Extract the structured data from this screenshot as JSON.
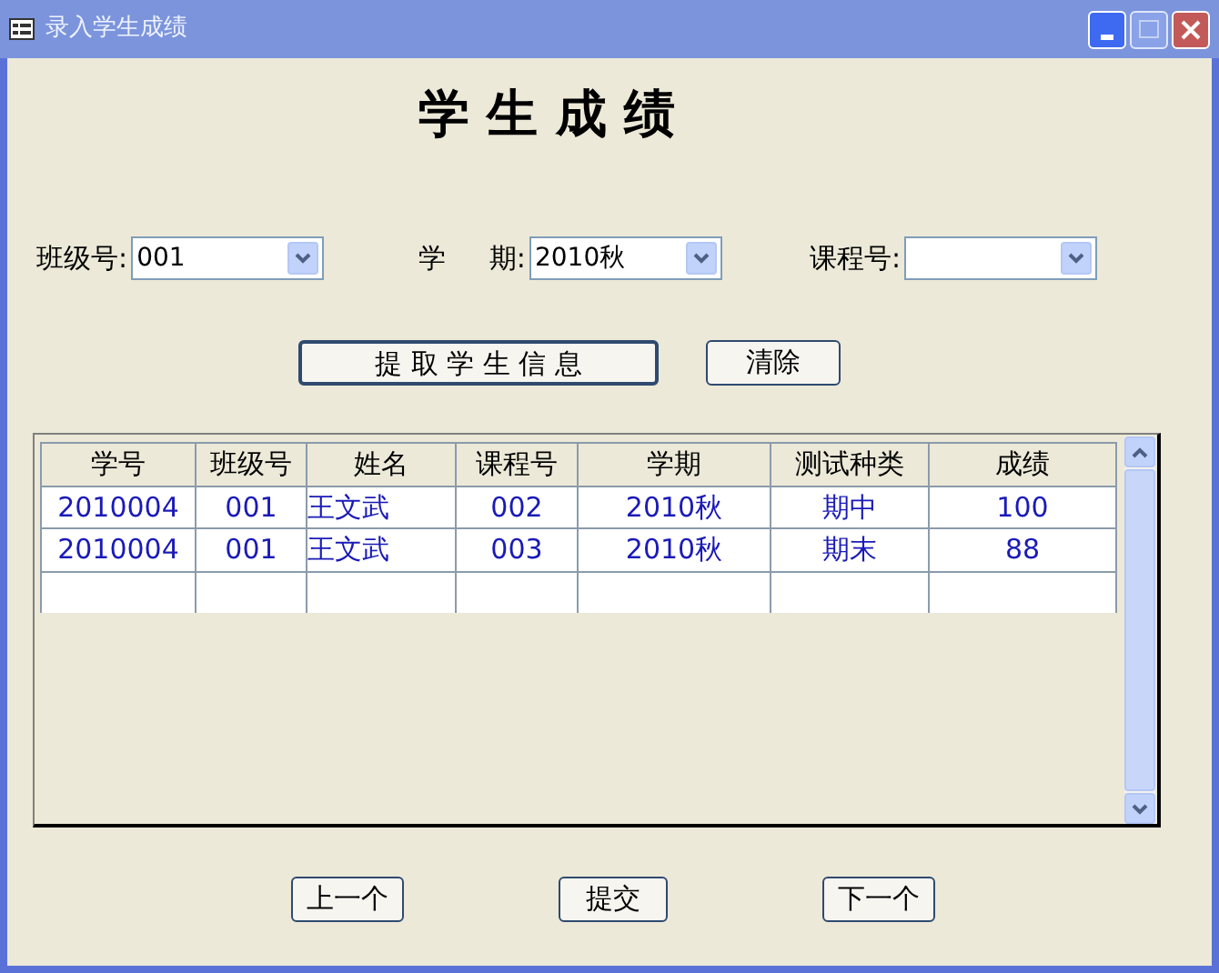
{
  "window": {
    "title": "录入学生成绩"
  },
  "heading": "学 生 成 绩",
  "filters": [
    {
      "label": "班级号:",
      "value": "001"
    },
    {
      "label": "学     期:",
      "value": "2010秋"
    },
    {
      "label": "课程号:"
    }
  ],
  "actions": [
    "提 取 学 生 信 息",
    "清除"
  ],
  "table": {
    "columns": [
      "学号",
      "班级号",
      "姓名",
      "课程号",
      "学期",
      "测试种类",
      "成绩"
    ],
    "rows": [
      [
        "2010004",
        "001",
        "王文武",
        "002",
        "2010秋",
        "期中",
        "100"
      ],
      [
        "2010004",
        "001",
        "王文武",
        "003",
        "2010秋",
        "期末",
        "88"
      ]
    ]
  },
  "nav_buttons": [
    "上一个",
    "提交",
    "下一个"
  ]
}
